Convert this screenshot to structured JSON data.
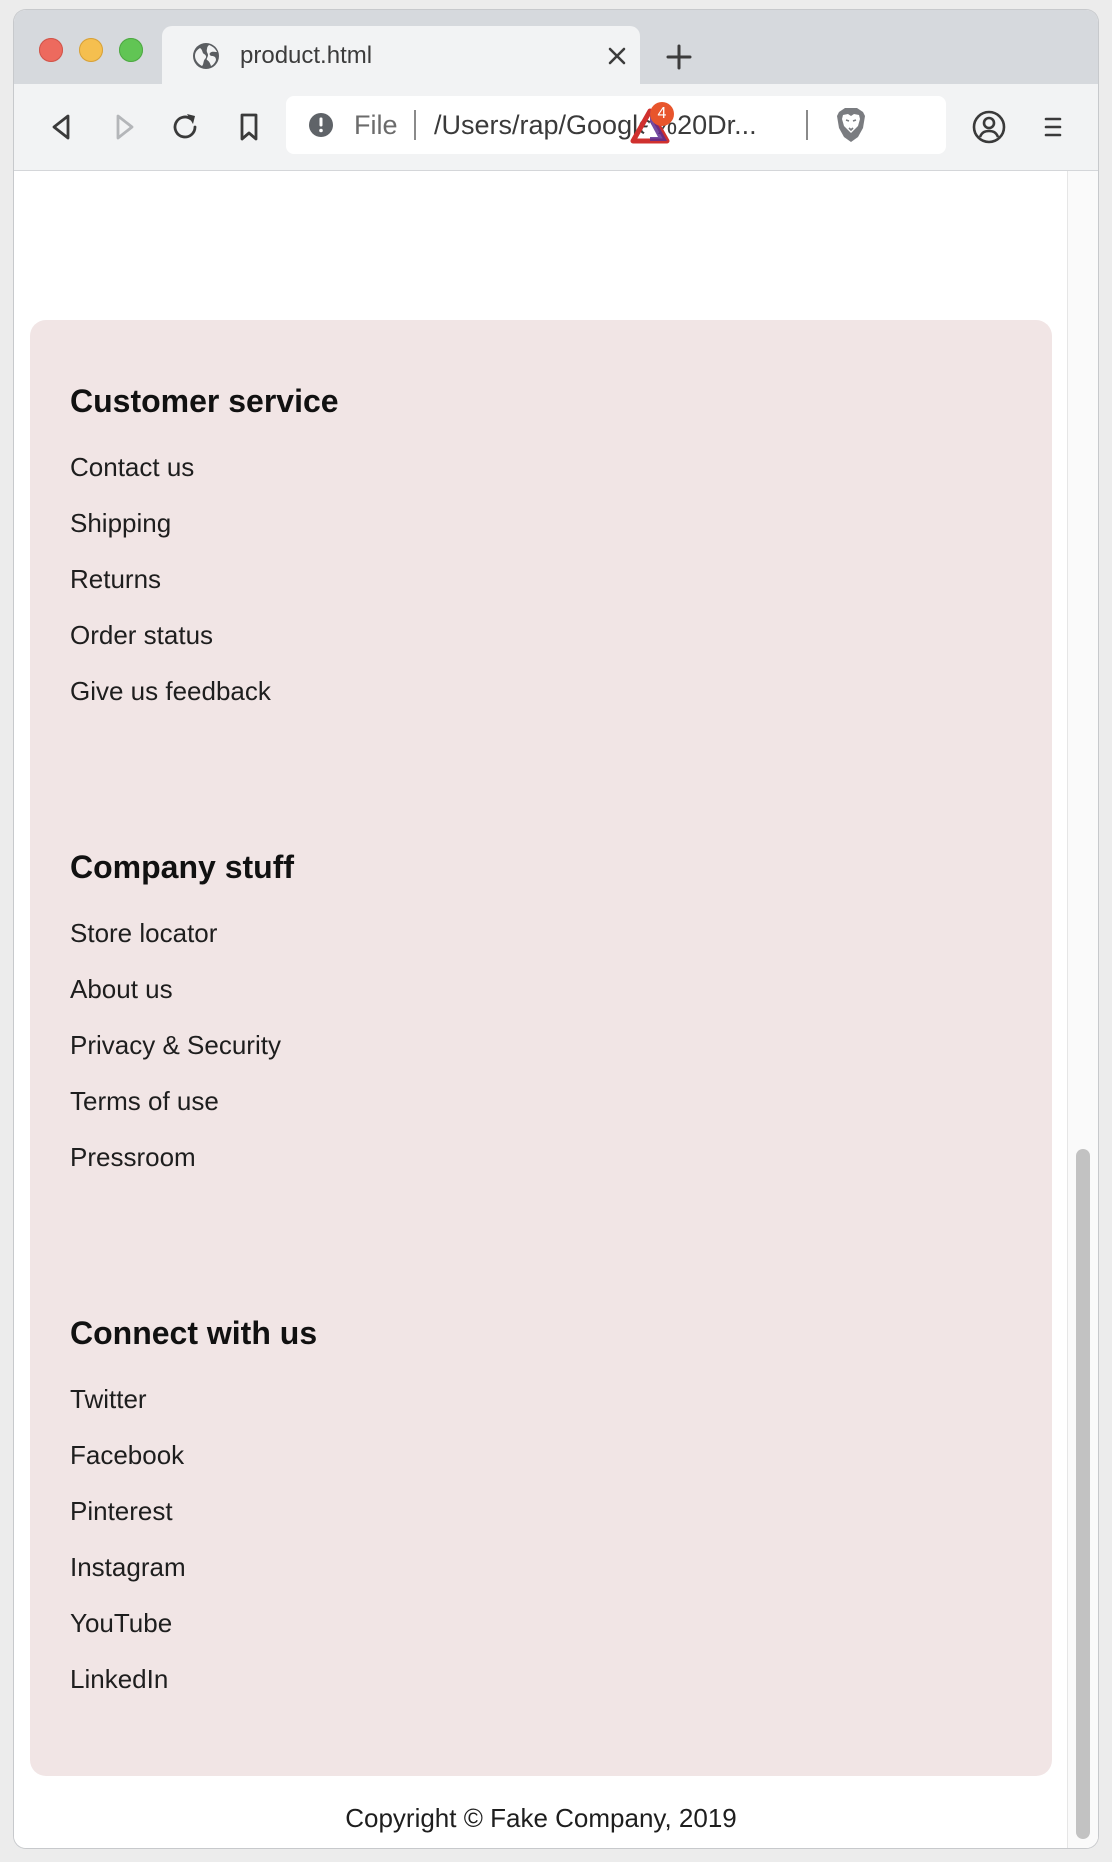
{
  "browser": {
    "tab": {
      "title": "product.html",
      "icon": "globe-icon",
      "close_icon": "close-icon"
    },
    "new_tab_icon": "plus-icon",
    "toolbar": {
      "back_icon": "back-arrow-icon",
      "forward_icon": "forward-arrow-icon",
      "reload_icon": "reload-icon",
      "bookmark_icon": "bookmark-icon",
      "site_info_icon": "info-icon",
      "scheme_label": "File",
      "url": "/Users/rap/Google%20Dr...",
      "shields_icon": "brave-lion-icon",
      "rewards_icon": "brave-rewards-icon",
      "rewards_badge": "4",
      "profile_icon": "profile-icon",
      "menu_icon": "menu-icon"
    }
  },
  "footer": {
    "background": "#f1e5e5",
    "sections": [
      {
        "heading": "Customer service",
        "links": [
          "Contact us",
          "Shipping",
          "Returns",
          "Order status",
          "Give us feedback"
        ]
      },
      {
        "heading": "Company stuff",
        "links": [
          "Store locator",
          "About us",
          "Privacy & Security",
          "Terms of use",
          "Pressroom"
        ]
      },
      {
        "heading": "Connect with us",
        "links": [
          "Twitter",
          "Facebook",
          "Pinterest",
          "Instagram",
          "YouTube",
          "LinkedIn"
        ]
      }
    ],
    "copyright": "Copyright © Fake Company, 2019"
  }
}
